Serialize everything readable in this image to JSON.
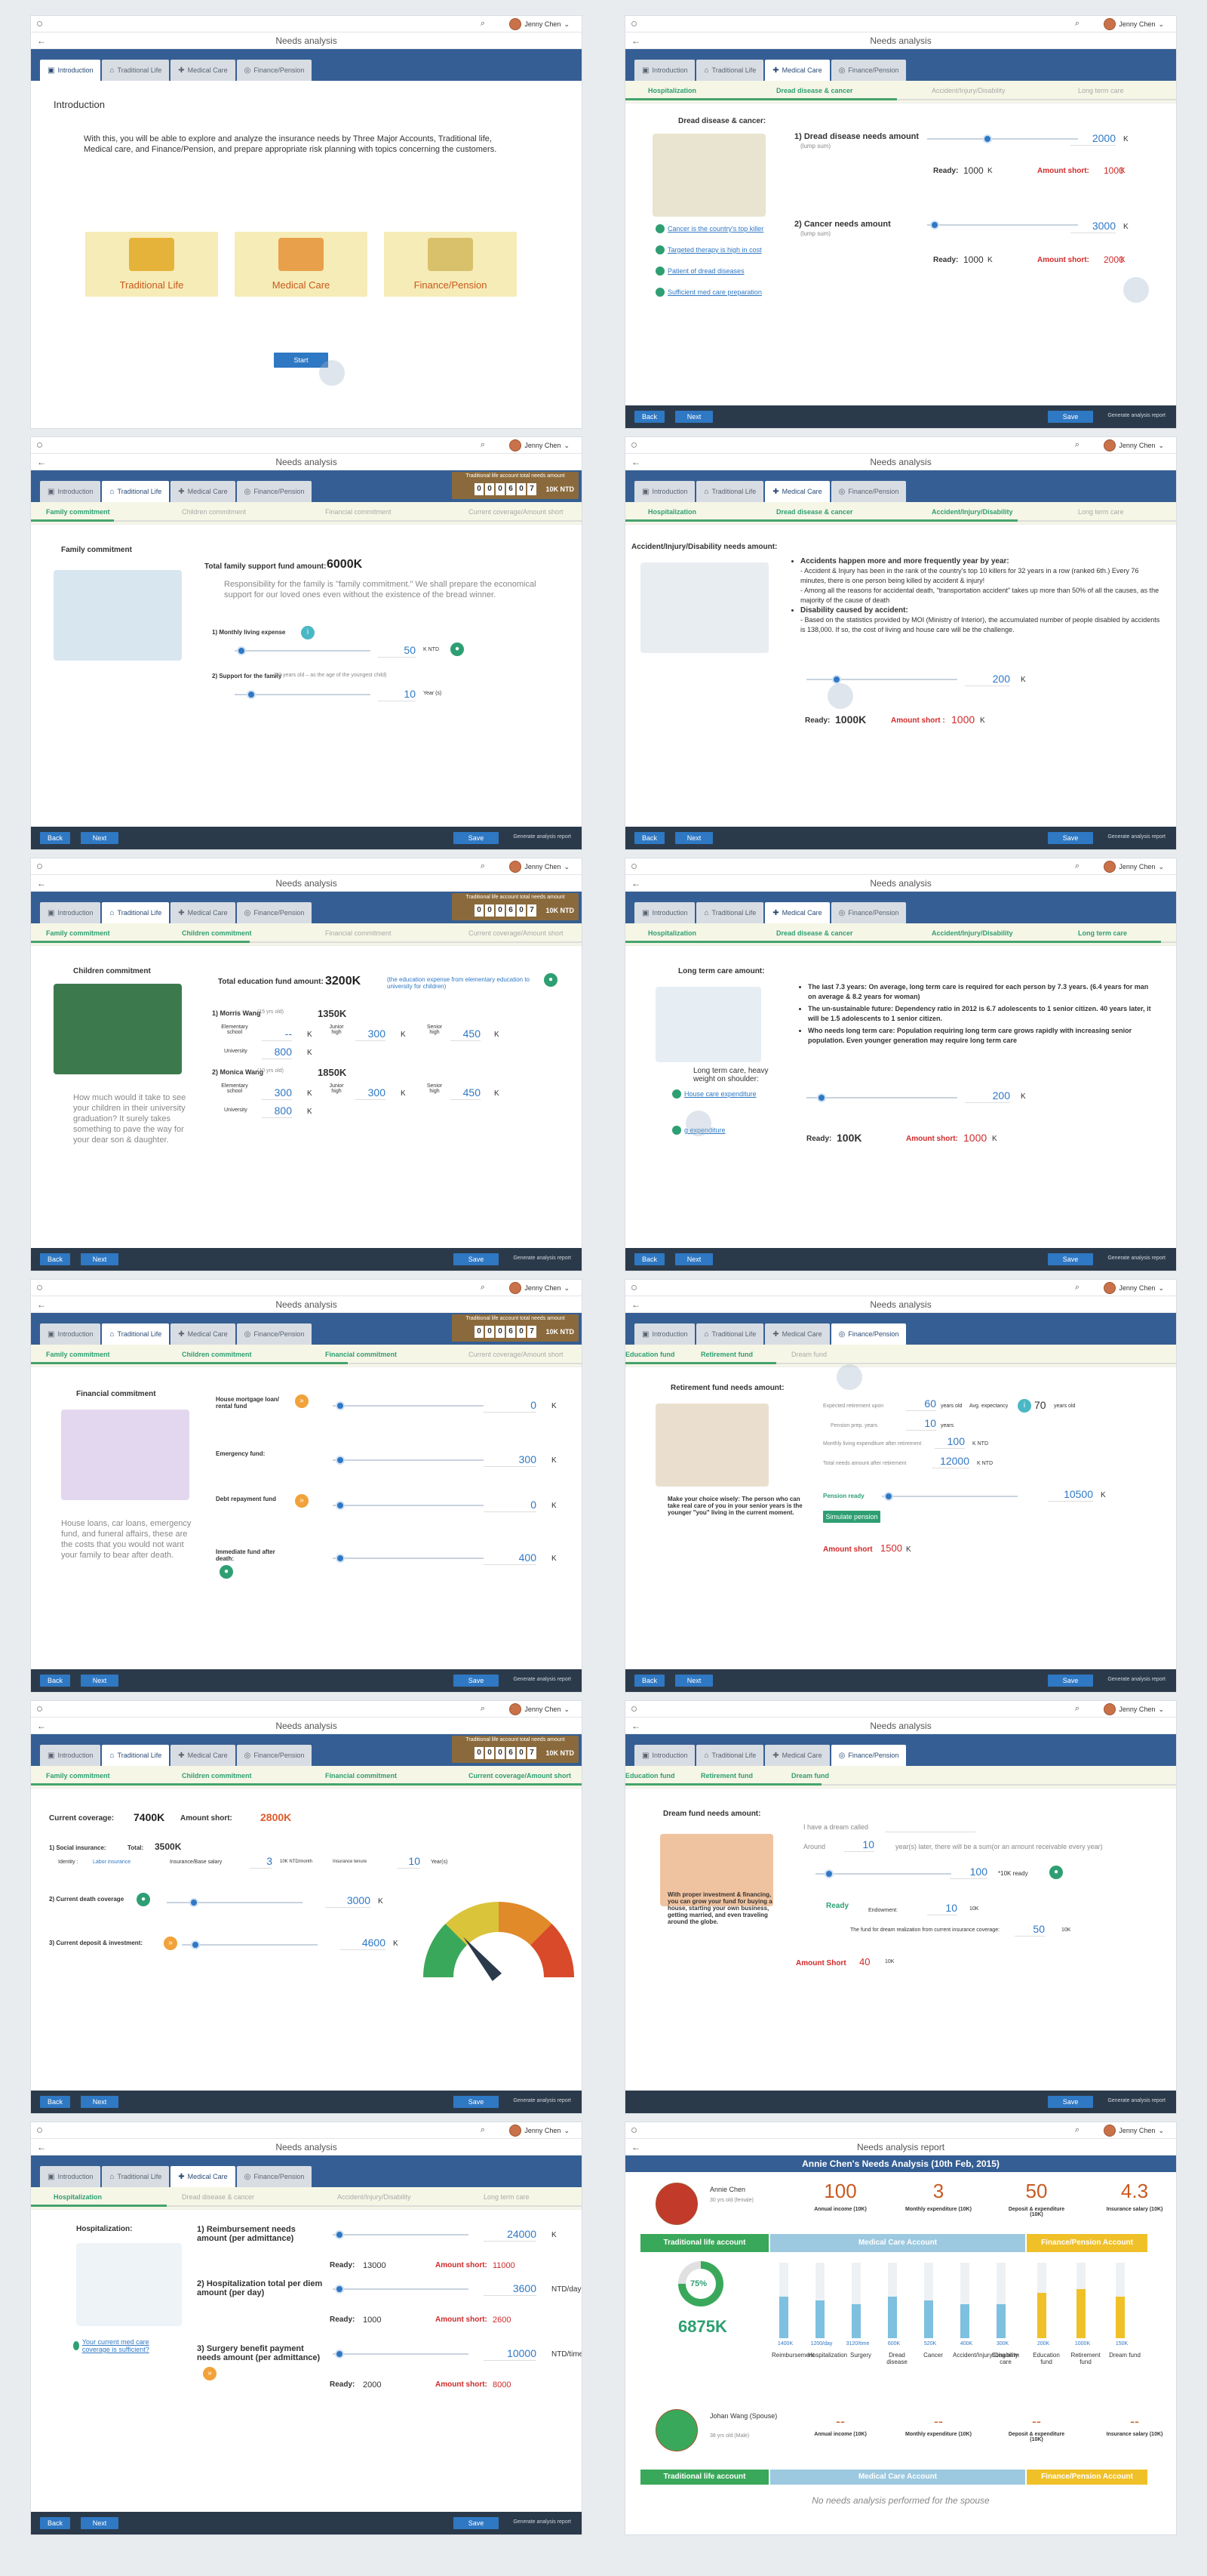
{
  "app": {
    "title": "Needs analysis",
    "user": "Jenny Chen",
    "report_title": "Needs analysis report"
  },
  "tabs": [
    "Introduction",
    "Traditional Life",
    "Medical Care",
    "Finance/Pension"
  ],
  "footer": {
    "back": "Back",
    "next": "Next",
    "save": "Save",
    "generate": "Generate analysis report"
  },
  "counter": {
    "title": "Traditional life account total needs amount",
    "digits": [
      "0",
      "0",
      "0",
      "6",
      "0",
      "7"
    ],
    "unit": "10K NTD"
  },
  "s1": {
    "heading": "Introduction",
    "text": "With this, you will be able to explore and analyze the insurance needs by Three Major Accounts, Traditional life, Medical care, and Finance/Pension, and prepare appropriate risk planning with topics concerning the customers.",
    "cards": [
      "Traditional Life",
      "Medical Care",
      "Finance/Pension"
    ],
    "start": "Start"
  },
  "med_steps": [
    "Hospitalization",
    "Dread disease & cancer",
    "Accident/Injury/Disability",
    "Long term care"
  ],
  "life_steps": [
    "Family commitment",
    "Children commitment",
    "Financial commitment",
    "Current coverage/Amount short"
  ],
  "s2": {
    "heading": "Dread disease & cancer:",
    "q1": "1) Dread disease needs amount",
    "q1s": "(lump sum)",
    "v1": "2000",
    "ready_label": "Ready:",
    "ready1": "1000",
    "k": "K",
    "short_label": "Amount short:",
    "short1": "1000",
    "q2": "2) Cancer needs amount",
    "q2s": "(lump sum)",
    "v2": "3000",
    "ready2": "1000",
    "short2": "2000",
    "links": [
      "Cancer is the country's top killer",
      "Targeted therapy is high in cost",
      "Patient of dread diseases",
      "Sufficient med care preparation"
    ]
  },
  "s3": {
    "heading": "Family commitment",
    "fund_label": "Total family support fund amount:",
    "fund": "6000K",
    "desc": "Responsibility for the family is \"family commitment.\" We shall prepare the economical support for our loved ones even without the existence of the bread winner.",
    "q1": "1) Monthly living expense",
    "v1": "50",
    "u1": "K NTD",
    "q2": "2) Support for the family",
    "q2s": "(22 years old – as the age of the youngest child)",
    "v2": "10",
    "u2": "Year (s)"
  },
  "s4": {
    "heading": "Accident/Injury/Disability needs amount:",
    "b1": "Accidents happen more and more frequently year by year:",
    "b1a": "- Accident & Injury has been in the rank of the country's top 10 killers for 32 years in a row (ranked 6th.) Every 76 minutes, there is one person being killed by accident & injury!",
    "b1b": "- Among all the reasons for accidental death, \"transportation accident\" takes up more than 50% of all the causes, as the majority of the cause of death",
    "b2": "Disability caused by accident:",
    "b2a": "- Based on the statistics provided by MOI (Ministry of Interior), the accumulated number of people disabled by accidents is 138,000. If so, the cost of living and house care will be the challenge.",
    "v": "200",
    "k": "K",
    "ready_label": "Ready:",
    "ready": "1000K",
    "short_label": "Amount short :",
    "short": "1000",
    "short_k": "K"
  },
  "s5": {
    "heading": "Children commitment",
    "fund_label": "Total education fund amount:",
    "fund": "3200K",
    "note": "(the education expense from elementary education to university for children)",
    "c1": "1) Morris Wang",
    "c1age": "(15 yrs old)",
    "c1amt": "1350K",
    "c2": "2) Monica Wang",
    "c2age": "(10 yrs old)",
    "c2amt": "1850K",
    "elem": "Elementary school",
    "junior": "Junior high",
    "senior": "Senior high",
    "univ": "University",
    "c1e": "--",
    "c1j": "300",
    "c1s": "450",
    "c1u": "800",
    "c2e": "300",
    "c2j": "300",
    "c2s": "450",
    "c2u": "800",
    "k": "K",
    "desc": "How much would it take to see your children in their university graduation? It surely takes something to pave the way for your dear son & daughter."
  },
  "s6": {
    "heading": "Long term care amount:",
    "b1": "The last 7.3 years: On average, long term care is required for each person by 7.3 years. (6.4 years for man on average & 8.2 years for woman)",
    "b2": "The un-sustainable future: Dependency ratio in 2012 is 6.7 adolescents to 1 senior citizen. 40 years later, it will be 1.5 adolescents to 1 senior citizen.",
    "b3": "Who needs long term care: Population requiring long term care grows rapidly with increasing senior population. Even younger generation may require long term care",
    "note": "Long term care, heavy weight on shoulder:",
    "l1": "House care expenditure",
    "l2": "g expenditure",
    "v": "200",
    "k": "K",
    "ready_label": "Ready:",
    "ready": "100K",
    "short_label": "Amount short:",
    "short": "1000",
    "short_k": "K"
  },
  "s7": {
    "heading": "Financial commitment",
    "q1": "House mortgage loan/ rental fund",
    "v1": "0",
    "q2": "Emergency fund:",
    "v2": "300",
    "q3": "Debt repayment fund",
    "v3": "0",
    "q4": "Immediate fund after death:",
    "v4": "400",
    "k": "K",
    "desc": "House loans, car loans, emergency fund, and funeral affairs, these are the costs that you would not want your family to bear after death."
  },
  "pen_steps": [
    "Education fund",
    "Retirement fund",
    "Dream fund"
  ],
  "s8": {
    "heading": "Retirement fund needs amount:",
    "r1": "Expected retirement upon",
    "r1v": "60",
    "r1u": "years old",
    "r1b": "Avg. expectancy",
    "r1bv": "70",
    "r1bu": "years old",
    "r2": "Pension prep. years",
    "r2v": "10",
    "r2u": "years",
    "r3": "Monthly living expenditure after retirement",
    "r3v": "100",
    "r3u": "K NTD",
    "r4": "Total needs amount after retirement",
    "r4v": "12000",
    "r4u": "K NTD",
    "desc": "Make your choice wisely: The person who can take real care of you in your senior years is the younger \"you\" living in the current moment.",
    "ready": "Pension ready",
    "ready_v": "10500",
    "k": "K",
    "sim": "Simulate pension",
    "short_label": "Amount short",
    "short": "1500",
    "short_k": "K"
  },
  "s9": {
    "cur_label": "Current coverage:",
    "cur": "7400K",
    "short_label": "Amount short:",
    "short": "2800K",
    "q1": "1) Social insurance:",
    "total_label": "Total:",
    "total": "3500K",
    "identity": "Identity :",
    "identity_v": "Labor insurance",
    "base": "Insurance/Base salary",
    "base_v": "3",
    "base_u": "10K NTD/month",
    "years_label": "Insurance tenure",
    "years_v": "10",
    "years_u": "Year(s)",
    "q2": "2) Current death coverage",
    "v2": "3000",
    "q3": "3) Current deposit & investment:",
    "v3": "4600",
    "k": "K"
  },
  "s10": {
    "heading": "Dream fund needs amount:",
    "dream": "I have a dream called",
    "around": "Around",
    "around_v": "10",
    "after": "year(s) later, there will be a sum(or an amount receivable every year)",
    "amt": "100",
    "ready_k": "*10K ready",
    "desc": "With proper investment & financing, you can grow your fund for buying a house, starting your own business, getting married, and even traveling around the globe.",
    "ready": "Ready",
    "endow": "Endowment:",
    "endow_v": "10",
    "endow_u": "10K",
    "cover": "The fund for dream realization from current insurance coverage:",
    "cover_v": "50",
    "cover_u": "10K",
    "short_label": "Amount Short",
    "short": "40",
    "short_u": "10K"
  },
  "s11": {
    "heading": "Hospitalization:",
    "q1": "1) Reimbursement needs amount (per admittance)",
    "v1": "24000",
    "u1": "K",
    "ready1": "13000",
    "short1": "11000",
    "q2": "2) Hospitalization total per diem amount (per day)",
    "v2": "3600",
    "u2": "NTD/day",
    "ready2": "1000",
    "short2": "2600",
    "q3": "3) Surgery benefit payment needs amount (per admittance)",
    "v3": "10000",
    "u3": "NTD/time",
    "ready3": "2000",
    "short3": "8000",
    "ready_label": "Ready:",
    "short_label": "Amount short:",
    "k": "K",
    "link": "Your current med care coverage is sufficient?"
  },
  "s12": {
    "title": "Annie Chen's Needs Analysis (10th Feb, 2015)",
    "p1": "Annie Chen",
    "p1sub": "30 yrs old (female)",
    "stats": [
      {
        "v": "100",
        "l": "Annual income (10K)"
      },
      {
        "v": "3",
        "l": "Monthly expenditure (10K)"
      },
      {
        "v": "50",
        "l": "Deposit & expenditure (10K)"
      },
      {
        "v": "4.3",
        "l": "Insurance salary (10K)"
      }
    ],
    "acc": [
      "Traditional life account",
      "Medical Care Account",
      "Finance/Pension Account"
    ],
    "pct": "75%",
    "amt": "6875K",
    "med_bars": [
      {
        "v": "1400K",
        "l": "Reimbursement",
        "h": 0.55
      },
      {
        "v": "1200/day",
        "l": "Hospitalization",
        "h": 0.5
      },
      {
        "v": "3120/time",
        "l": "Surgery",
        "h": 0.45
      },
      {
        "v": "600K",
        "l": "Dread disease",
        "h": 0.55
      },
      {
        "v": "520K",
        "l": "Cancer",
        "h": 0.5
      },
      {
        "v": "400K",
        "l": "Accident/Injury/Disability",
        "h": 0.45
      },
      {
        "v": "300K",
        "l": "Long term care",
        "h": 0.45
      }
    ],
    "fin_bars": [
      {
        "v": "200K",
        "l": "Education fund",
        "h": 0.6
      },
      {
        "v": "1000K",
        "l": "Retirement fund",
        "h": 0.65
      },
      {
        "v": "150K",
        "l": "Dream fund",
        "h": 0.55
      }
    ],
    "p2": "Johan Wang (Spouse)",
    "p2sub": "38 yrs old (Male)",
    "dash": "--",
    "nospouse": "No needs analysis performed for the spouse"
  }
}
